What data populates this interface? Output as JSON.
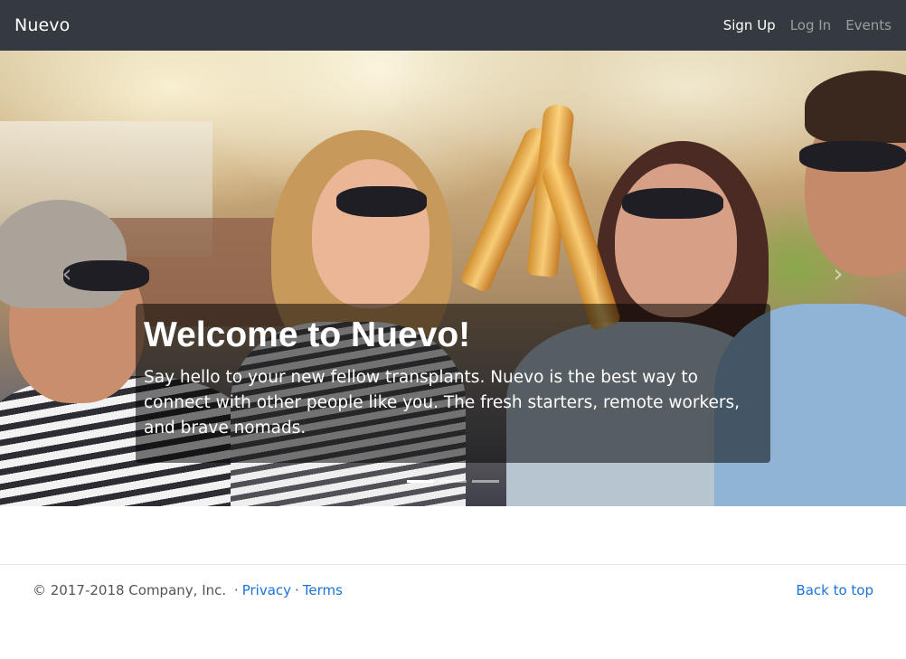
{
  "navbar": {
    "brand": "Nuevo",
    "links": [
      {
        "label": "Sign Up",
        "active": true
      },
      {
        "label": "Log In",
        "active": false
      },
      {
        "label": "Events",
        "active": false
      }
    ]
  },
  "carousel": {
    "caption_title": "Welcome to Nuevo!",
    "caption_text": "Say hello to your new fellow transplants. Nuevo is the best way to connect with other people like you. The fresh starters, remote workers, and brave nomads.",
    "prev_icon": "chevron-left-icon",
    "next_icon": "chevron-right-icon",
    "indicators": 3,
    "active_indicator": 1
  },
  "footer": {
    "copyright": "© 2017-2018 Company, Inc.",
    "separator": "·",
    "privacy": "Privacy",
    "terms": "Terms",
    "back_to_top": "Back to top"
  },
  "colors": {
    "navbar_bg": "#343a40",
    "link": "#1a73d9"
  }
}
